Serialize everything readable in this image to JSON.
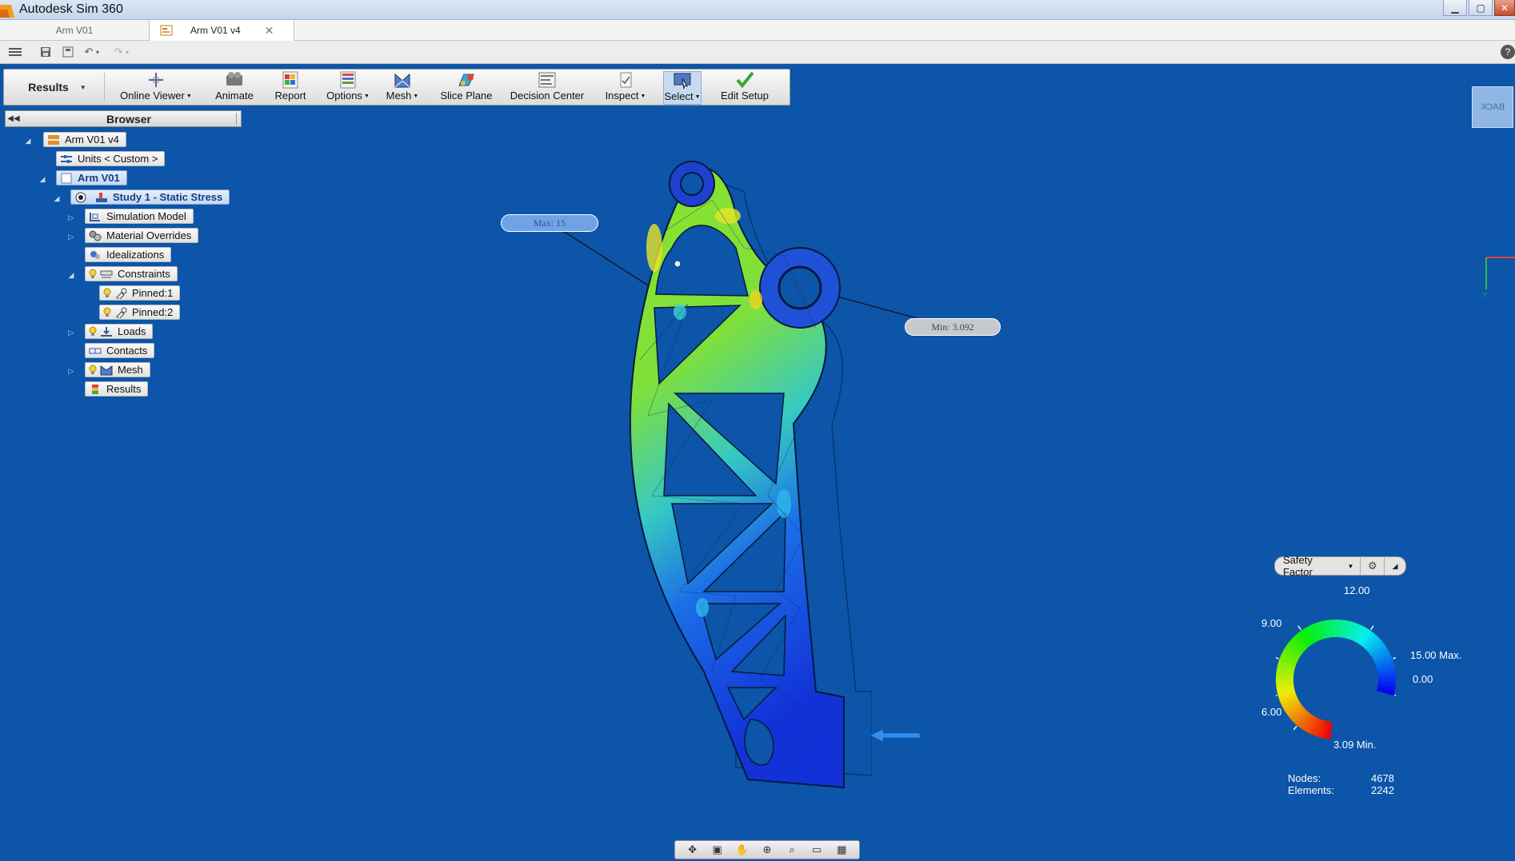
{
  "app": {
    "title": "Autodesk Sim 360"
  },
  "doc_tabs": [
    {
      "label": "Arm V01"
    },
    {
      "label": "Arm V01 v4",
      "close": "✕"
    }
  ],
  "ribbon": {
    "mode": "Results",
    "buttons": [
      {
        "label": "Online Viewer",
        "icon": "online-viewer-icon"
      },
      {
        "label": "Animate",
        "icon": "animate-icon"
      },
      {
        "label": "Report",
        "icon": "report-icon"
      },
      {
        "label": "Options",
        "icon": "options-icon"
      },
      {
        "label": "Mesh",
        "icon": "mesh-icon"
      },
      {
        "label": "Slice Plane",
        "icon": "slice-plane-icon"
      },
      {
        "label": "Decision Center",
        "icon": "decision-center-icon"
      },
      {
        "label": "Inspect",
        "icon": "inspect-icon"
      },
      {
        "label": "Select",
        "icon": "select-icon"
      },
      {
        "label": "Edit Setup",
        "icon": "checkmark-icon"
      }
    ]
  },
  "browser": {
    "title": "Browser",
    "tree": {
      "root": "Arm V01 v4",
      "units": "Units < Custom >",
      "model": "Arm V01",
      "study": "Study 1 - Static Stress",
      "simulation_model": "Simulation Model",
      "material_overrides": "Material Overrides",
      "idealizations": "Idealizations",
      "constraints": "Constraints",
      "pinned1": "Pinned:1",
      "pinned2": "Pinned:2",
      "loads": "Loads",
      "contacts": "Contacts",
      "mesh": "Mesh",
      "results": "Results"
    }
  },
  "viewport": {
    "probe_max": "Max: 15",
    "probe_min": "Min: 3.092",
    "viewcube_label": "BACK"
  },
  "legend": {
    "result_type": "Safety Factor",
    "ticks": {
      "t12": "12.00",
      "t9": "9.00",
      "t15": "15.00 Max.",
      "t0": "0.00",
      "t6": "6.00",
      "tmin": "3.09 Min."
    },
    "max": 15.0,
    "min": 3.09
  },
  "stats": {
    "nodes_label": "Nodes:",
    "nodes": "4678",
    "elements_label": "Elements:",
    "elements": "2242"
  },
  "colors": {
    "background": "#0c55a8",
    "highlight": "#c4d8f3"
  }
}
